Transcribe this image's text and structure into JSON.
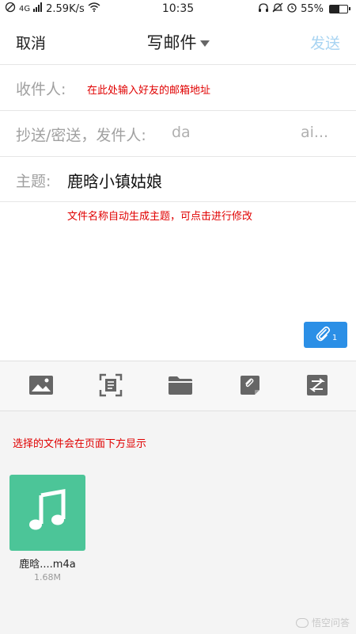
{
  "status_bar": {
    "signal_text": "4G",
    "speed": "2.59K/s",
    "time": "10:35",
    "battery": "55%",
    "battery_level": 0.55,
    "icons": [
      "no-disturb-icon",
      "signal-icon",
      "wifi-icon",
      "headset-icon",
      "mute-icon",
      "alarm-icon",
      "battery-icon"
    ]
  },
  "header": {
    "cancel_label": "取消",
    "title": "写邮件",
    "send_label": "发送",
    "send_color": "#a8d4f2"
  },
  "fields": {
    "to_label": "收件人:",
    "to_hint": "在此处输入好友的邮箱地址",
    "cc_label": "抄送/密送，发件人:",
    "cc_value_start": "da",
    "cc_value_end": "ai...",
    "subject_label": "主题:",
    "subject_value": "鹿晗小镇姑娘"
  },
  "body": {
    "hint": "文件名称自动生成主题，可点击进行修改"
  },
  "attachment_badge": {
    "count": "1",
    "color": "#2b8fe6"
  },
  "toolbar": {
    "tools": [
      "image-icon",
      "scan-icon",
      "folder-icon",
      "note-icon",
      "transfer-icon"
    ]
  },
  "panel": {
    "hint": "选择的文件会在页面下方显示",
    "file": {
      "name": "鹿晗....m4a",
      "size": "1.68M",
      "thumb_color": "#4cc598"
    }
  },
  "watermark": {
    "text": "悟空问答"
  },
  "colors": {
    "annotation_red": "#e00000"
  }
}
